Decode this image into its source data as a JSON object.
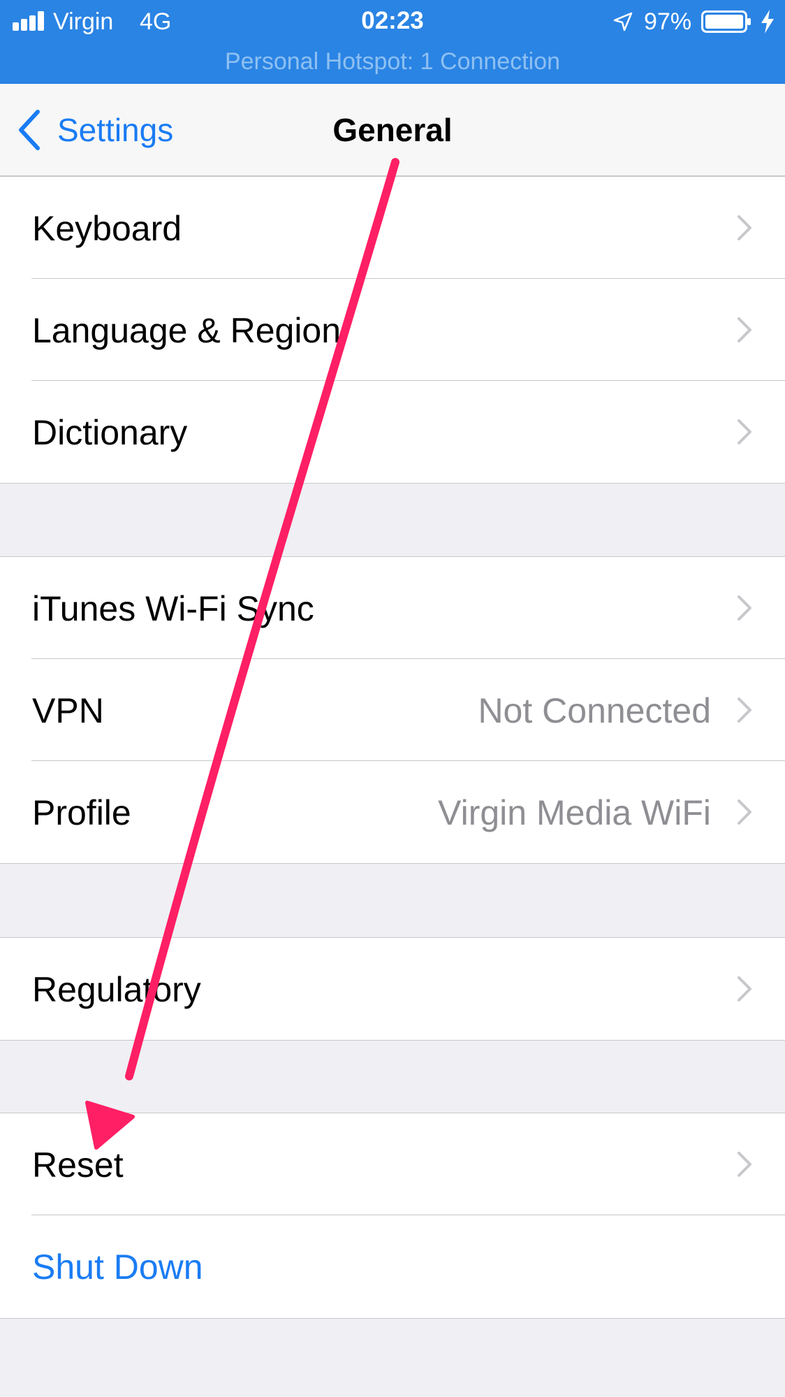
{
  "status_bar": {
    "carrier": "Virgin",
    "network": "4G",
    "time": "02:23",
    "battery_percent": "97%",
    "hotspot_banner": "Personal Hotspot: 1 Connection",
    "background_color": "#2a84e4"
  },
  "nav": {
    "back_label": "Settings",
    "title": "General"
  },
  "groups": [
    {
      "rows": [
        {
          "label": "Keyboard",
          "value": ""
        },
        {
          "label": "Language & Region",
          "value": ""
        },
        {
          "label": "Dictionary",
          "value": ""
        }
      ]
    },
    {
      "rows": [
        {
          "label": "iTunes Wi-Fi Sync",
          "value": ""
        },
        {
          "label": "VPN",
          "value": "Not Connected"
        },
        {
          "label": "Profile",
          "value": "Virgin Media WiFi"
        }
      ]
    },
    {
      "rows": [
        {
          "label": "Regulatory",
          "value": ""
        }
      ]
    },
    {
      "rows": [
        {
          "label": "Reset",
          "value": ""
        },
        {
          "label": "Shut Down",
          "value": ""
        }
      ]
    }
  ],
  "colors": {
    "accent": "#1a7cf4",
    "annotation_arrow": "#ff1f64",
    "secondary_text": "#8e8e93",
    "background": "#efeff4"
  },
  "icons": {
    "back": "chevron-left-icon",
    "disclosure": "chevron-right-icon",
    "location": "location-arrow-icon",
    "battery": "battery-icon",
    "charging": "lightning-bolt-icon",
    "signal": "cellular-signal-icon"
  }
}
